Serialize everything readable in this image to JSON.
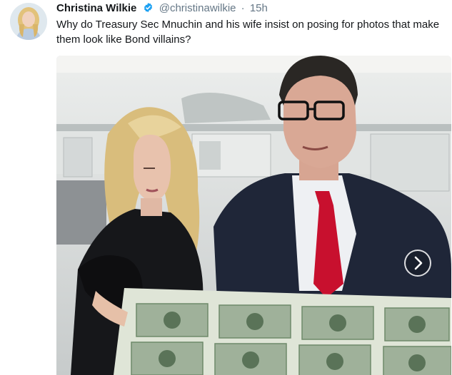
{
  "tweet": {
    "author_name": "Christina Wilkie",
    "handle": "@christinawilkie",
    "separator": "·",
    "time": "15h",
    "text": "Why do Treasury Sec Mnuchin and his wife insist on posing for photos that make them look like Bond villains?",
    "verified": true
  },
  "media": {
    "next_icon": "chevron-right-icon"
  },
  "colors": {
    "verified": "#1da1f2",
    "meta_text": "#657786",
    "body_text": "#14171a",
    "tie": "#c8102e",
    "suit": "#1f2638",
    "currency_sheet": "#dfe5d7",
    "bill_green": "#6f8a6a"
  }
}
